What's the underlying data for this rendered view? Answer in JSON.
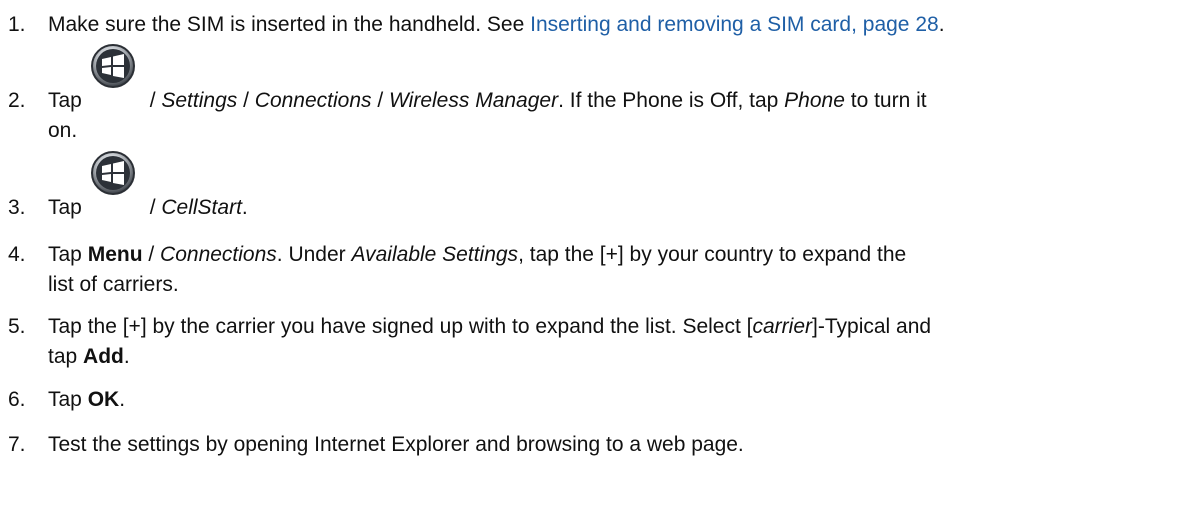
{
  "steps": {
    "s1": {
      "num": "1.",
      "text_before": "Make sure the SIM is inserted in the handheld. See ",
      "link": "Inserting and removing a SIM card, page 28",
      "text_after": "."
    },
    "s2": {
      "num": "2.",
      "tap": "Tap",
      "sep1": " / ",
      "settings": "Settings",
      "sep2": " / ",
      "connections": "Connections",
      "sep3": " / ",
      "wireless": "Wireless Manager",
      "mid": ". If the Phone is Off, tap ",
      "phone": "Phone",
      "end": " to turn it",
      "cont": "on."
    },
    "s3": {
      "num": "3.",
      "tap": "Tap",
      "sep": " / ",
      "cellstart": "CellStart",
      "end": "."
    },
    "s4": {
      "num": "4.",
      "tap": "Tap ",
      "menu": "Menu",
      "sep": " / ",
      "connections": "Connections",
      "mid": ". Under ",
      "available": "Available Settings",
      "end": ", tap the [+] by your country to expand the",
      "cont": "list of carriers."
    },
    "s5": {
      "num": "5.",
      "text1": "Tap the [+] by the carrier you have signed up with to expand the list. Select [",
      "carrier": "carrier",
      "text2": "]-Typical and",
      "cont_tap": "tap ",
      "add": "Add",
      "end": "."
    },
    "s6": {
      "num": "6.",
      "tap": "Tap ",
      "ok": "OK",
      "end": "."
    },
    "s7": {
      "num": "7.",
      "text": "Test the settings by opening Internet Explorer and browsing to a web page."
    }
  },
  "icons": {
    "start": "windows-start-icon"
  }
}
